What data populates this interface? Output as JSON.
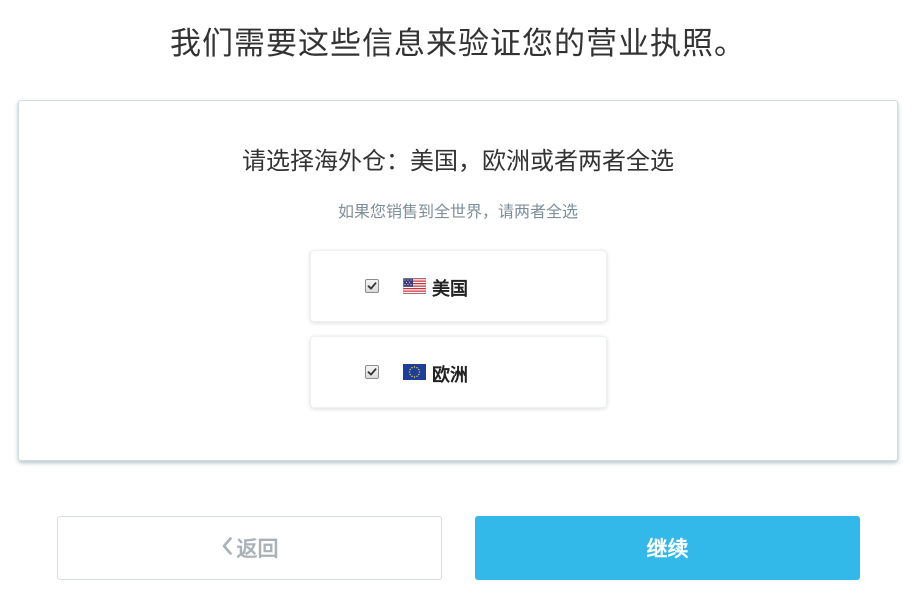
{
  "page": {
    "title": "我们需要这些信息来验证您的营业执照。"
  },
  "selection": {
    "heading": "请选择海外仓：美国，欧洲或者两者全选",
    "subheading": "如果您销售到全世界，请两者全选",
    "options": [
      {
        "label": "美国",
        "checked": true,
        "icon": "us-flag-icon"
      },
      {
        "label": "欧洲",
        "checked": true,
        "icon": "eu-flag-icon"
      }
    ]
  },
  "footer": {
    "back_label": "返回",
    "back_icon": "chevron-left-icon",
    "continue_label": "继续"
  },
  "colors": {
    "accent": "#33b9e9",
    "border": "#cfdde3",
    "muted_text": "#aab2b7"
  }
}
